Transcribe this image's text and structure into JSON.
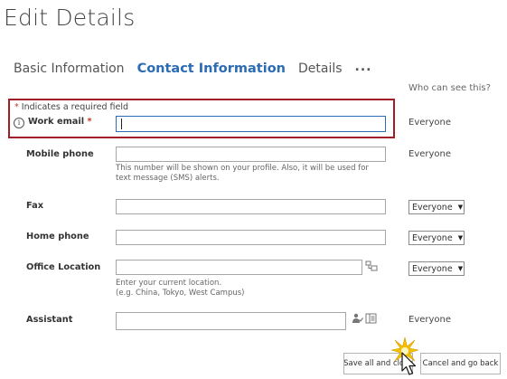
{
  "page": {
    "title": "Edit Details"
  },
  "tabs": [
    {
      "label": "Basic Information",
      "active": false
    },
    {
      "label": "Contact Information",
      "active": true
    },
    {
      "label": "Details",
      "active": false
    },
    {
      "label": "...",
      "active": false
    }
  ],
  "visibility_header": "Who can see this?",
  "required_note": {
    "star": "*",
    "text": " Indicates a required field"
  },
  "fields": {
    "work_email": {
      "label": "Work email",
      "required_star": " *",
      "value": "",
      "visibility": "Everyone"
    },
    "mobile_phone": {
      "label": "Mobile phone",
      "value": "",
      "help": "This number will be shown on your profile. Also, it will be used for text message (SMS) alerts.",
      "visibility": "Everyone"
    },
    "fax": {
      "label": "Fax",
      "value": "",
      "visibility": "Everyone"
    },
    "home_phone": {
      "label": "Home phone",
      "value": "",
      "visibility": "Everyone"
    },
    "office_location": {
      "label": "Office Location",
      "value": "",
      "help_line1": "Enter your current location.",
      "help_line2": "(e.g. China, Tokyo, West Campus)",
      "visibility": "Everyone"
    },
    "assistant": {
      "label": "Assistant",
      "value": "",
      "visibility": "Everyone"
    }
  },
  "buttons": {
    "save_close": "Save all and close",
    "cancel": "Cancel and go back"
  },
  "icons": {
    "info": "info-icon",
    "location_picker": "location-picker-icon",
    "people_picker": "people-picker-icon",
    "address_book": "address-book-icon",
    "dropdown": "dropdown-arrow-icon",
    "cursor": "mouse-cursor-icon"
  },
  "colors": {
    "accent": "#2b6cb5",
    "highlight_border": "#a31d26",
    "required_star": "#c0392b",
    "click_burst": "#f2c200"
  }
}
